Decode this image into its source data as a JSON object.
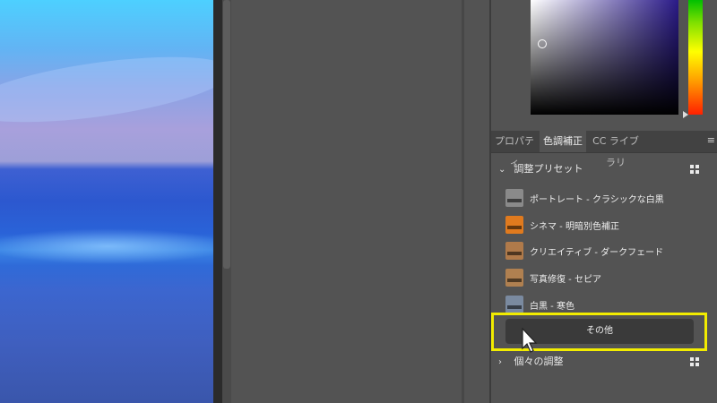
{
  "tabs": [
    {
      "label": "プロパティ",
      "active": false
    },
    {
      "label": "色調補正",
      "active": true
    },
    {
      "label": "CC ライブラリ",
      "active": false
    }
  ],
  "tab_menu_icon": "≡",
  "preset_section": {
    "title": "調整プリセット",
    "items": [
      {
        "label": "ポートレート - クラシックな白黒",
        "thumb_color": "#8a8a8a"
      },
      {
        "label": "シネマ - 明暗別色補正",
        "thumb_color": "#e07a1e"
      },
      {
        "label": "クリエイティブ - ダークフェード",
        "thumb_color": "#b07a4a"
      },
      {
        "label": "写真修復 - セピア",
        "thumb_color": "#b08050"
      },
      {
        "label": "白黒 - 寒色",
        "thumb_color": "#7a8aa0"
      }
    ],
    "other_button": "その他"
  },
  "individual_section": {
    "title": "個々の調整"
  },
  "colors": {
    "highlight": "#f2ec00",
    "panel_bg": "#535353"
  }
}
